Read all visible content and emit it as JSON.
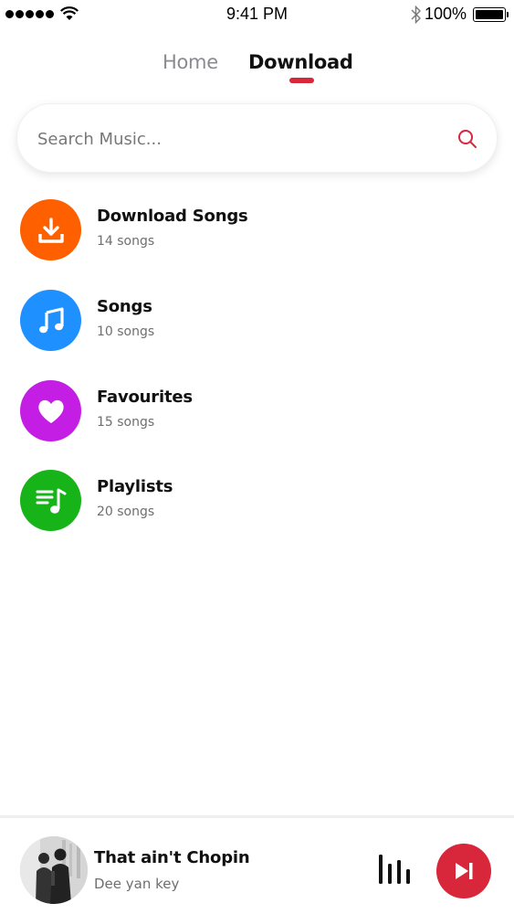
{
  "status_bar": {
    "time": "9:41 PM",
    "battery": "100%"
  },
  "tabs": [
    {
      "label": "Home",
      "active": false
    },
    {
      "label": "Download",
      "active": true
    }
  ],
  "search": {
    "placeholder": "Search Music...",
    "value": "",
    "icon": "search-icon"
  },
  "categories": [
    {
      "title": "Download Songs",
      "count": "14 songs",
      "icon": "download-icon",
      "color": "#fe6000"
    },
    {
      "title": "Songs",
      "count": "10 songs",
      "icon": "music-note-icon",
      "color": "#1e90ff"
    },
    {
      "title": "Favourites",
      "count": "15 songs",
      "icon": "heart-icon",
      "color": "#c41ee4"
    },
    {
      "title": "Playlists",
      "count": "20 songs",
      "icon": "playlist-icon",
      "color": "#16b418"
    }
  ],
  "now_playing": {
    "title": "That ain't Chopin",
    "artist": "Dee yan key"
  },
  "colors": {
    "accent": "#d8263a"
  }
}
